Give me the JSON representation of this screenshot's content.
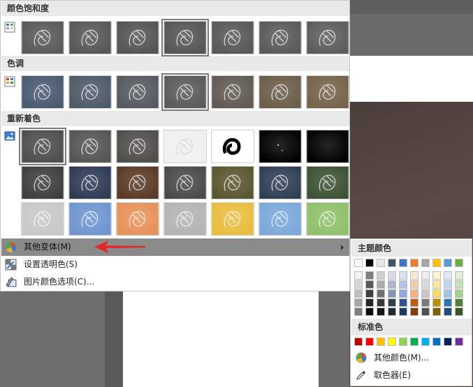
{
  "sections": {
    "saturation": {
      "title": "颜色饱和度"
    },
    "tone": {
      "title": "色调"
    },
    "recolor": {
      "title": "重新着色"
    }
  },
  "menu": {
    "more_variants": "其他变体(M)",
    "set_transparent": "设置透明色(S)",
    "picture_color_options": "图片颜色选项(C)..."
  },
  "submenu": {
    "theme_colors_title": "主题颜色",
    "standard_colors_title": "标准色",
    "more_colors": "其他颜色(M)...",
    "eyedropper": "取色器(E)",
    "theme_top_row": [
      "#ffffff",
      "#000000",
      "#e7e6e6",
      "#44546a",
      "#4472c4",
      "#ed7d31",
      "#a5a5a5",
      "#ffc000",
      "#5b9bd5",
      "#70ad47"
    ],
    "theme_shades": [
      [
        "#f2f2f2",
        "#7f7f7f",
        "#d0cece",
        "#d6dce4",
        "#d9e2f3",
        "#fbe5d5",
        "#ededed",
        "#fff2cc",
        "#deebf6",
        "#e2efd9"
      ],
      [
        "#d8d8d8",
        "#595959",
        "#aeabab",
        "#adb9ca",
        "#b4c6e7",
        "#f7cbac",
        "#dbdbdb",
        "#fee599",
        "#bdd7ee",
        "#c5e0b3"
      ],
      [
        "#bfbfbf",
        "#3f3f3f",
        "#757070",
        "#8496b0",
        "#8eaadb",
        "#f4b183",
        "#c9c9c9",
        "#ffd965",
        "#9dc3e6",
        "#a8d08d"
      ],
      [
        "#a5a5a5",
        "#262626",
        "#3a3838",
        "#323f4f",
        "#2f5496",
        "#c55a11",
        "#7b7b7b",
        "#bf8f00",
        "#2e75b5",
        "#538135"
      ],
      [
        "#7f7f7f",
        "#0c0c0c",
        "#171616",
        "#222a35",
        "#1f3864",
        "#833c0b",
        "#525252",
        "#7f6000",
        "#1e4e79",
        "#375623"
      ]
    ],
    "standard": [
      "#c00000",
      "#ff0000",
      "#ffc000",
      "#ffff00",
      "#92d050",
      "#00b050",
      "#00b0f0",
      "#0070c0",
      "#002060",
      "#7030a0"
    ]
  },
  "thumbnails": {
    "saturation": [
      "#5a5a5a",
      "#575757",
      "#555555",
      "#555555",
      "#585858",
      "#5a5a5a",
      "#5d5d5d"
    ],
    "tone": [
      "#4a5a70",
      "#4f5a68",
      "#555a60",
      "#5a5a5a",
      "#605a52",
      "#6b5e4a",
      "#75634a"
    ],
    "recolor_row1": [
      "#4e4e4e",
      "#555555",
      "#4f4e4a",
      "#f0f0f0",
      "#ffffff",
      "#000000",
      "#000000"
    ],
    "recolor_row2": [
      "#3e3e3e",
      "#2f3b55",
      "#5a3a26",
      "#4a4a4a",
      "#5a5630",
      "#2e3f55",
      "#3d5234"
    ],
    "recolor_row3": [
      "#c8c8c8",
      "#6f95d0",
      "#e8915a",
      "#b4b4b4",
      "#e9bd3e",
      "#7ba8dc",
      "#8fc06a"
    ]
  }
}
